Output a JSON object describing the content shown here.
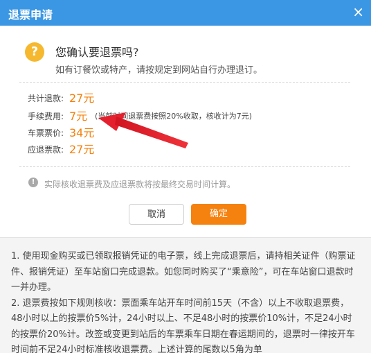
{
  "dialog": {
    "title": "退票申请",
    "close_glyph": "×",
    "question_icon_glyph": "?",
    "question": "您确认要退票吗?",
    "subtext": "如有订餐饮或特产，请按规定到网站自行办理退订。",
    "fees": {
      "total_label": "共计退款:",
      "total_value": "27元",
      "service_label": "手续费用:",
      "service_value": "7元",
      "service_note": "(当前时间退票费按照20%收取，核收计为7元)",
      "ticket_label": "车票票价:",
      "ticket_value": "34元",
      "refund_label": "应退票款:",
      "refund_value": "27元"
    },
    "info_icon_glyph": "!",
    "info": "实际核收退票费及应退票款将按最终交易时间计算。",
    "buttons": {
      "cancel": "取消",
      "confirm": "确定"
    },
    "rules": {
      "p1": "1. 使用现金购买或已领取报销凭证的电子票，线上完成退票后，请持相关证件（购票证件、报销凭证）至车站窗口完成退款。如您同时购买了“乘意险”，可在车站窗口退款时一并办理。",
      "p2": "2. 退票费按如下规则核收：票面乘车站开车时间前15天（不含）以上不收取退票费，48小时以上的按票价5%计，24小时以上、不足48小时的按票价10%计，不足24小时的按票价20%计。改签或变更到站后的车票乘车日期在春运期间的，退票时一律按开车时间前不足24小时标准核收退票费。上述计算的尾数以5角为单"
    }
  },
  "colors": {
    "titlebar": "#3b97e3",
    "accent_orange": "#f5800a",
    "question_icon": "#f5b82e",
    "annotation_arrow": "#e5202e"
  }
}
